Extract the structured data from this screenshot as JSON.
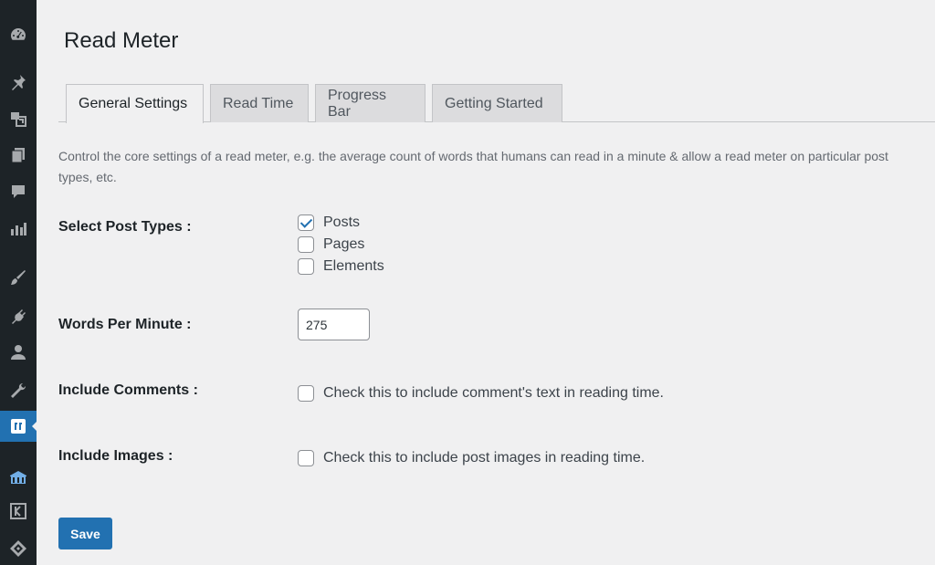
{
  "sidebar": {
    "icons": [
      {
        "name": "dashboard-icon"
      },
      {
        "name": "posts-pin-icon"
      },
      {
        "name": "media-icon"
      },
      {
        "name": "pages-icon"
      },
      {
        "name": "comments-icon"
      },
      {
        "name": "analytics-icon"
      },
      {
        "name": "appearance-brush-icon"
      },
      {
        "name": "plugins-icon"
      },
      {
        "name": "users-icon"
      },
      {
        "name": "tools-wrench-icon"
      },
      {
        "name": "read-meter-icon",
        "active": true
      },
      {
        "name": "building-icon"
      },
      {
        "name": "k-logo-icon"
      },
      {
        "name": "diamond-icon"
      }
    ]
  },
  "page": {
    "title": "Read Meter"
  },
  "tabs": [
    {
      "label": "General Settings",
      "active": true
    },
    {
      "label": "Read Time"
    },
    {
      "label": "Progress Bar"
    },
    {
      "label": "Getting Started"
    }
  ],
  "description": "Control the core settings of a read meter, e.g. the average count of words that humans can read in a minute & allow a read meter on particular post types, etc.",
  "settings": {
    "post_types": {
      "label": "Select Post Types :",
      "options": [
        {
          "label": "Posts",
          "checked": true
        },
        {
          "label": "Pages",
          "checked": false
        },
        {
          "label": "Elements",
          "checked": false
        }
      ]
    },
    "words_per_minute": {
      "label": "Words Per Minute :",
      "value": "275"
    },
    "include_comments": {
      "label": "Include Comments :",
      "text": "Check this to include comment's text in reading time.",
      "checked": false
    },
    "include_images": {
      "label": "Include Images :",
      "text": "Check this to include post images in reading time.",
      "checked": false
    }
  },
  "actions": {
    "save_label": "Save"
  },
  "colors": {
    "sidebar_bg": "#1d2327",
    "accent": "#2271b1",
    "page_bg": "#f0f0f1"
  }
}
